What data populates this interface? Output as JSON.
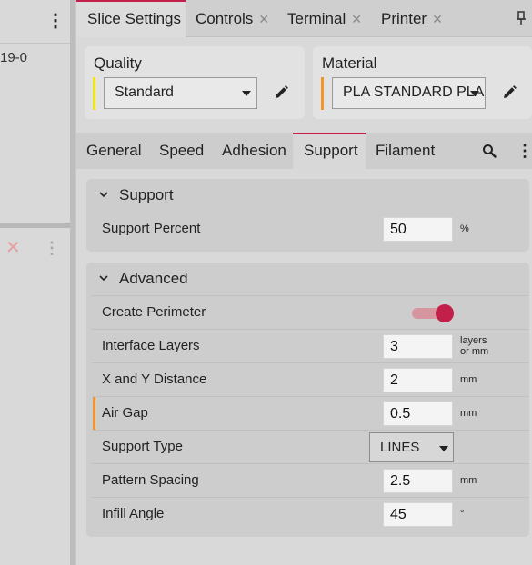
{
  "left_pane": {
    "menu_glyph": "⋮",
    "item_id": "19-0",
    "remove_glyph": "✕",
    "more_glyph": "⋮"
  },
  "tabs": [
    {
      "label": "Slice Settings",
      "active": true,
      "closable": false
    },
    {
      "label": "Controls",
      "active": false,
      "closable": true
    },
    {
      "label": "Terminal",
      "active": false,
      "closable": true
    },
    {
      "label": "Printer",
      "active": false,
      "closable": true
    }
  ],
  "tab_close_glyph": "✕",
  "quality": {
    "title": "Quality",
    "value": "Standard",
    "accent": "#f2e51a"
  },
  "material": {
    "title": "Material",
    "value": "PLA STANDARD PLA",
    "accent": "#f0962c"
  },
  "categories": [
    "General",
    "Speed",
    "Adhesion",
    "Support",
    "Filament"
  ],
  "active_category": "Support",
  "more_glyph": "⋮",
  "support_group": {
    "title": "Support",
    "rows": [
      {
        "label": "Support Percent",
        "value": "50",
        "unit": "%"
      }
    ]
  },
  "advanced_group": {
    "title": "Advanced",
    "create_perimeter": {
      "label": "Create Perimeter",
      "on": true
    },
    "interface_layers": {
      "label": "Interface Layers",
      "value": "3",
      "unit_line1": "layers",
      "unit_line2": "or mm"
    },
    "xy_distance": {
      "label": "X and Y Distance",
      "value": "2",
      "unit": "mm"
    },
    "air_gap": {
      "label": "Air Gap",
      "value": "0.5",
      "unit": "mm"
    },
    "support_type": {
      "label": "Support Type",
      "value": "LINES"
    },
    "pattern_spacing": {
      "label": "Pattern Spacing",
      "value": "2.5",
      "unit": "mm"
    },
    "infill_angle": {
      "label": "Infill Angle",
      "value": "45",
      "unit": "°"
    }
  },
  "colors": {
    "accent": "#c2204a",
    "override_flag": "#f0962c",
    "quality_flag": "#f2e51a"
  }
}
